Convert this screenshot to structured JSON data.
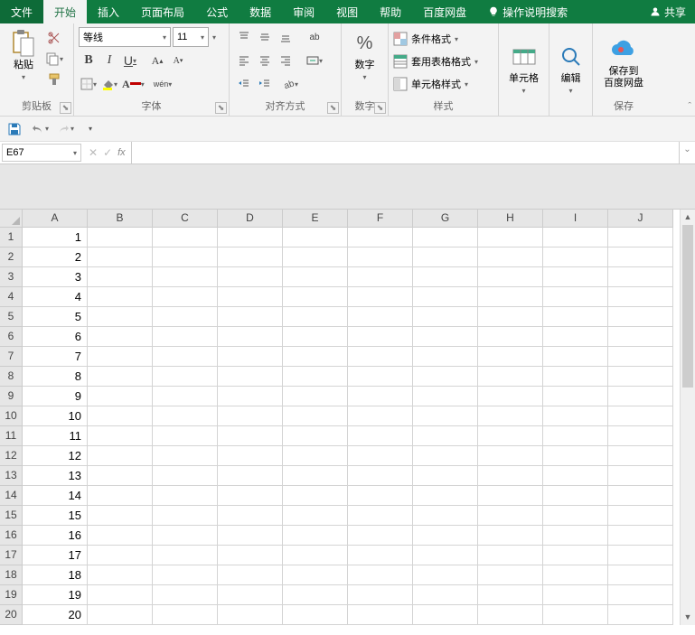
{
  "tabs": {
    "file": "文件",
    "home": "开始",
    "insert": "插入",
    "layout": "页面布局",
    "formulas": "公式",
    "data": "数据",
    "review": "审阅",
    "view": "视图",
    "help": "帮助",
    "baidu": "百度网盘",
    "tell": "操作说明搜索",
    "share": "共享"
  },
  "ribbon": {
    "clipboard": {
      "label": "剪贴板",
      "paste": "粘贴"
    },
    "font": {
      "label": "字体",
      "name": "等线",
      "size": "11",
      "bold": "B",
      "italic": "I",
      "underline": "U",
      "wen": "wén"
    },
    "align": {
      "label": "对齐方式",
      "wrap": "ab"
    },
    "number": {
      "label": "数字",
      "btn": "数字",
      "pct": "%"
    },
    "styles": {
      "label": "样式",
      "cond": "条件格式",
      "table": "套用表格格式",
      "cell": "单元格样式"
    },
    "cells": {
      "label": "单元格"
    },
    "editing": {
      "label": "编辑"
    },
    "save": {
      "label": "保存",
      "btn1": "保存到",
      "btn2": "百度网盘"
    }
  },
  "namebox": "E67",
  "columns": [
    "A",
    "B",
    "C",
    "D",
    "E",
    "F",
    "G",
    "H",
    "I",
    "J"
  ],
  "rows": [
    1,
    2,
    3,
    4,
    5,
    6,
    7,
    8,
    9,
    10,
    11,
    12,
    13,
    14,
    15,
    16,
    17,
    18,
    19,
    20
  ],
  "cellsA": [
    "1",
    "2",
    "3",
    "4",
    "5",
    "6",
    "7",
    "8",
    "9",
    "10",
    "11",
    "12",
    "13",
    "14",
    "15",
    "16",
    "17",
    "18",
    "19",
    "20"
  ]
}
